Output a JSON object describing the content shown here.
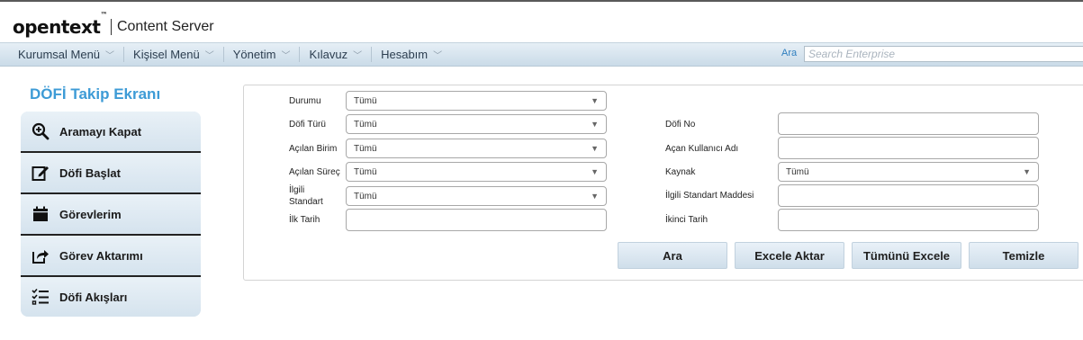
{
  "brand": {
    "logo": "opentext",
    "tm": "™",
    "product": "Content Server"
  },
  "menu": [
    {
      "label": "Kurumsal Menü"
    },
    {
      "label": "Kişisel Menü"
    },
    {
      "label": "Yönetim"
    },
    {
      "label": "Kılavuz"
    },
    {
      "label": "Hesabım"
    }
  ],
  "search": {
    "label": "Ara",
    "placeholder": "Search Enterprise"
  },
  "page_title": "DÖFİ Takip Ekranı",
  "sidebar": [
    {
      "label": "Aramayı Kapat",
      "icon": "search-minus-icon"
    },
    {
      "label": "Döfi Başlat",
      "icon": "edit-icon"
    },
    {
      "label": "Görevlerim",
      "icon": "calendar-icon"
    },
    {
      "label": "Görev Aktarımı",
      "icon": "share-icon"
    },
    {
      "label": "Döfi Akışları",
      "icon": "list-check-icon"
    }
  ],
  "form": {
    "durumu": {
      "label": "Durumu",
      "value": "Tümü"
    },
    "dofi_turu": {
      "label": "Döfi Türü",
      "value": "Tümü"
    },
    "acilan_birim": {
      "label": "Açılan Birim",
      "value": "Tümü"
    },
    "acilan_surec": {
      "label": "Açılan Süreç",
      "value": "Tümü"
    },
    "ilgili_standart": {
      "label1": "İlgili",
      "label2": "Standart",
      "value": "Tümü"
    },
    "ilk_tarih": {
      "label": "İlk Tarih",
      "value": ""
    },
    "dofi_no": {
      "label": "Döfi No",
      "value": ""
    },
    "acan_kullanici": {
      "label": "Açan Kullanıcı Adı",
      "value": ""
    },
    "kaynak": {
      "label": "Kaynak",
      "value": "Tümü"
    },
    "ilgili_madde": {
      "label": "İlgili Standart Maddesi",
      "value": ""
    },
    "ikinci_tarih": {
      "label": "İkinci Tarih",
      "value": ""
    }
  },
  "buttons": {
    "ara": "Ara",
    "excele_aktar": "Excele Aktar",
    "tumunu_excele": "Tümünü Excele",
    "temizle": "Temizle"
  }
}
